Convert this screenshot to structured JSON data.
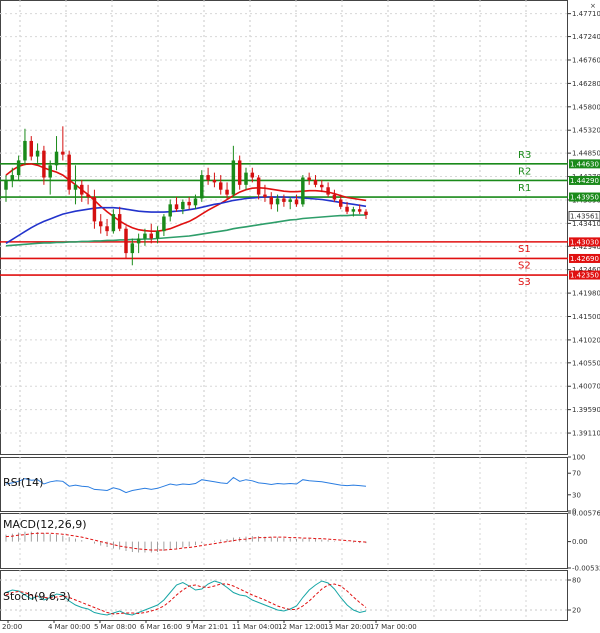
{
  "chart_data": {
    "type": "candlestick",
    "price_axis": {
      "ylim": [
        1.3866,
        1.4799
      ],
      "ticks": [
        1.4771,
        1.4724,
        1.4676,
        1.4628,
        1.458,
        1.4532,
        1.4485,
        1.4437,
        1.4389,
        1.4341,
        1.4294,
        1.4246,
        1.4198,
        1.415,
        1.4102,
        1.4055,
        1.4007,
        1.3959,
        1.3911
      ],
      "tick_labels": [
        "1.47710",
        "1.47240",
        "1.46760",
        "1.46280",
        "1.45800",
        "1.45320",
        "1.44850",
        "1.44370",
        "1.43890",
        "1.43410",
        "1.42940",
        "1.42460",
        "1.41980",
        "1.41500",
        "1.41020",
        "1.40550",
        "1.40070",
        "1.39590",
        "1.39110"
      ],
      "current_price": 1.43561,
      "current_price_label": "1.43561"
    },
    "time_axis": {
      "labels": [
        "20:00",
        "4 Mar 00:00",
        "5 Mar 08:00",
        "6 Mar 16:00",
        "9 Mar 21:01",
        "11 Mar 04:00",
        "12 Mar 12:00",
        "13 Mar 20:00",
        "17 Mar 00:00"
      ]
    },
    "levels": [
      {
        "name": "R3",
        "value": 1.4463,
        "label": "1.44630",
        "color": "#1a8a1a"
      },
      {
        "name": "R2",
        "value": 1.4429,
        "label": "1.44290",
        "color": "#1a8a1a"
      },
      {
        "name": "R1",
        "value": 1.4395,
        "label": "1.43950",
        "color": "#1a8a1a"
      },
      {
        "name": "S1",
        "value": 1.4303,
        "label": "1.43030",
        "color": "#e01010"
      },
      {
        "name": "S2",
        "value": 1.4269,
        "label": "1.42690",
        "color": "#e01010"
      },
      {
        "name": "S3",
        "value": 1.4235,
        "label": "1.42350",
        "color": "#e01010"
      }
    ],
    "candles": [
      [
        1.441,
        1.444,
        1.4385,
        1.4428
      ],
      [
        1.4428,
        1.4455,
        1.4415,
        1.444
      ],
      [
        1.444,
        1.448,
        1.443,
        1.447
      ],
      [
        1.447,
        1.4535,
        1.446,
        1.451
      ],
      [
        1.451,
        1.452,
        1.447,
        1.4478
      ],
      [
        1.4478,
        1.4505,
        1.4465,
        1.449
      ],
      [
        1.449,
        1.45,
        1.442,
        1.4435
      ],
      [
        1.4435,
        1.447,
        1.44,
        1.446
      ],
      [
        1.446,
        1.452,
        1.445,
        1.4488
      ],
      [
        1.4488,
        1.454,
        1.447,
        1.4482
      ],
      [
        1.4482,
        1.449,
        1.44,
        1.441
      ],
      [
        1.441,
        1.446,
        1.438,
        1.442
      ],
      [
        1.442,
        1.443,
        1.4385,
        1.44
      ],
      [
        1.44,
        1.442,
        1.438,
        1.4395
      ],
      [
        1.4395,
        1.441,
        1.433,
        1.4345
      ],
      [
        1.4345,
        1.436,
        1.432,
        1.4335
      ],
      [
        1.4335,
        1.435,
        1.4315,
        1.4325
      ],
      [
        1.4325,
        1.437,
        1.432,
        1.436
      ],
      [
        1.436,
        1.4375,
        1.4325,
        1.433
      ],
      [
        1.433,
        1.4335,
        1.427,
        1.428
      ],
      [
        1.428,
        1.431,
        1.4255,
        1.43
      ],
      [
        1.43,
        1.432,
        1.428,
        1.431
      ],
      [
        1.431,
        1.433,
        1.4295,
        1.432
      ],
      [
        1.432,
        1.434,
        1.43,
        1.431
      ],
      [
        1.431,
        1.4335,
        1.43,
        1.4325
      ],
      [
        1.4325,
        1.436,
        1.4315,
        1.4355
      ],
      [
        1.4355,
        1.439,
        1.4345,
        1.438
      ],
      [
        1.438,
        1.4395,
        1.4365,
        1.437
      ],
      [
        1.437,
        1.439,
        1.436,
        1.4385
      ],
      [
        1.4385,
        1.4395,
        1.437,
        1.4378
      ],
      [
        1.4378,
        1.44,
        1.437,
        1.4392
      ],
      [
        1.4392,
        1.445,
        1.4385,
        1.444
      ],
      [
        1.444,
        1.4455,
        1.442,
        1.443
      ],
      [
        1.443,
        1.4445,
        1.4415,
        1.4425
      ],
      [
        1.4425,
        1.444,
        1.44,
        1.441
      ],
      [
        1.441,
        1.4425,
        1.439,
        1.44
      ],
      [
        1.44,
        1.45,
        1.4395,
        1.447
      ],
      [
        1.447,
        1.448,
        1.441,
        1.442
      ],
      [
        1.442,
        1.4455,
        1.441,
        1.4445
      ],
      [
        1.4445,
        1.4455,
        1.4425,
        1.4435
      ],
      [
        1.4435,
        1.444,
        1.439,
        1.44
      ],
      [
        1.44,
        1.442,
        1.4385,
        1.4395
      ],
      [
        1.4395,
        1.4405,
        1.437,
        1.438
      ],
      [
        1.438,
        1.44,
        1.4365,
        1.4392
      ],
      [
        1.4392,
        1.44,
        1.4375,
        1.4385
      ],
      [
        1.4385,
        1.4395,
        1.437,
        1.439
      ],
      [
        1.439,
        1.44,
        1.4375,
        1.438
      ],
      [
        1.438,
        1.444,
        1.4375,
        1.4435
      ],
      [
        1.4435,
        1.4445,
        1.442,
        1.443
      ],
      [
        1.443,
        1.444,
        1.4415,
        1.442
      ],
      [
        1.442,
        1.443,
        1.4405,
        1.4415
      ],
      [
        1.4415,
        1.4425,
        1.4395,
        1.44
      ],
      [
        1.44,
        1.441,
        1.4385,
        1.439
      ],
      [
        1.439,
        1.44,
        1.437,
        1.4375
      ],
      [
        1.4375,
        1.4385,
        1.436,
        1.4365
      ],
      [
        1.4365,
        1.4375,
        1.4355,
        1.437
      ],
      [
        1.437,
        1.438,
        1.436,
        1.4365
      ],
      [
        1.4365,
        1.437,
        1.435,
        1.4358
      ]
    ],
    "ma_series": [
      {
        "color": "#e01010",
        "values": [
          1.444,
          1.445,
          1.4458,
          1.4462,
          1.4463,
          1.446,
          1.4455,
          1.445,
          1.4446,
          1.444,
          1.443,
          1.442,
          1.441,
          1.44,
          1.4388,
          1.4376,
          1.4365,
          1.4355,
          1.4346,
          1.4338,
          1.4332,
          1.4328,
          1.4326,
          1.4325,
          1.4325,
          1.4327,
          1.433,
          1.4335,
          1.434,
          1.4345,
          1.4352,
          1.436,
          1.4368,
          1.4375,
          1.4382,
          1.439,
          1.4398,
          1.4405,
          1.441,
          1.4413,
          1.4414,
          1.4413,
          1.4411,
          1.4409,
          1.4407,
          1.4406,
          1.4406,
          1.4407,
          1.4408,
          1.4408,
          1.4407,
          1.4405,
          1.4402,
          1.4398,
          1.4394,
          1.4392,
          1.439,
          1.4388
        ]
      },
      {
        "color": "#2233cc",
        "values": [
          1.43,
          1.4308,
          1.4316,
          1.4324,
          1.4332,
          1.4339,
          1.4345,
          1.435,
          1.4355,
          1.436,
          1.4363,
          1.4366,
          1.4368,
          1.437,
          1.4372,
          1.4373,
          1.4373,
          1.4373,
          1.4372,
          1.437,
          1.4368,
          1.4366,
          1.4365,
          1.4364,
          1.4364,
          1.4364,
          1.4365,
          1.4366,
          1.4367,
          1.4369,
          1.4371,
          1.4374,
          1.4377,
          1.438,
          1.4382,
          1.4385,
          1.4388,
          1.439,
          1.4392,
          1.4393,
          1.4394,
          1.4395,
          1.4395,
          1.4395,
          1.4395,
          1.4394,
          1.4394,
          1.4393,
          1.4392,
          1.4391,
          1.439,
          1.4388,
          1.4386,
          1.4384,
          1.4382,
          1.438,
          1.4378,
          1.4376
        ]
      },
      {
        "color": "#2e9e6a",
        "values": [
          1.4295,
          1.4296,
          1.4297,
          1.4298,
          1.4299,
          1.43,
          1.4301,
          1.4301,
          1.4302,
          1.4302,
          1.4303,
          1.4303,
          1.4304,
          1.4304,
          1.4305,
          1.4305,
          1.4306,
          1.4306,
          1.4307,
          1.4307,
          1.4308,
          1.4308,
          1.4309,
          1.4309,
          1.431,
          1.4311,
          1.4312,
          1.4313,
          1.4314,
          1.4315,
          1.4317,
          1.4319,
          1.4321,
          1.4323,
          1.4325,
          1.4327,
          1.433,
          1.4332,
          1.4334,
          1.4336,
          1.4338,
          1.434,
          1.4342,
          1.4344,
          1.4346,
          1.4348,
          1.4349,
          1.4351,
          1.4352,
          1.4353,
          1.4354,
          1.4355,
          1.4356,
          1.4357,
          1.4357,
          1.4358,
          1.4358,
          1.4358
        ]
      }
    ],
    "rsi": {
      "label": "RSI(14)",
      "ylim": [
        0,
        100
      ],
      "ticks": [
        100,
        70,
        30,
        0
      ],
      "tick_labels": [
        "100",
        "70",
        "30",
        "0"
      ],
      "values": [
        50,
        52,
        55,
        60,
        57,
        58,
        50,
        54,
        56,
        55,
        46,
        48,
        46,
        45,
        40,
        39,
        38,
        43,
        40,
        34,
        38,
        40,
        42,
        40,
        42,
        46,
        50,
        48,
        50,
        49,
        51,
        58,
        56,
        54,
        52,
        51,
        62,
        55,
        58,
        56,
        52,
        51,
        49,
        51,
        50,
        51,
        50,
        58,
        56,
        55,
        54,
        52,
        50,
        48,
        47,
        48,
        47,
        46
      ],
      "color": "#2a7de1"
    },
    "macd": {
      "label": "MACD(12,26,9)",
      "ylim": [
        -0.005322,
        0.005764
      ],
      "ticks": [
        0.005764,
        0.0,
        -0.005322
      ],
      "tick_labels": [
        "0.005764",
        "0.00",
        "-0.005322"
      ],
      "histogram": [
        0.0014,
        0.0016,
        0.0018,
        0.002,
        0.002,
        0.0019,
        0.0017,
        0.0015,
        0.0014,
        0.0012,
        0.0009,
        0.0006,
        0.0003,
        0.0,
        -0.0004,
        -0.0008,
        -0.0011,
        -0.0014,
        -0.0016,
        -0.0019,
        -0.0021,
        -0.0022,
        -0.0022,
        -0.0022,
        -0.0021,
        -0.0019,
        -0.0016,
        -0.0014,
        -0.0012,
        -0.001,
        -0.0007,
        -0.0003,
        0.0,
        0.0002,
        0.0004,
        0.0005,
        0.0008,
        0.0009,
        0.001,
        0.0011,
        0.0011,
        0.001,
        0.0009,
        0.0008,
        0.0007,
        0.0006,
        0.0005,
        0.0006,
        0.0006,
        0.0005,
        0.0004,
        0.0003,
        0.0001,
        0.0,
        -0.0001,
        -0.0002,
        -0.0003,
        -0.0003
      ],
      "signal": [
        0.001,
        0.0011,
        0.0013,
        0.0014,
        0.0016,
        0.0017,
        0.0017,
        0.0017,
        0.0016,
        0.0015,
        0.0013,
        0.0011,
        0.0009,
        0.0006,
        0.0003,
        0.0,
        -0.0003,
        -0.0006,
        -0.0009,
        -0.0011,
        -0.0013,
        -0.0015,
        -0.0016,
        -0.0017,
        -0.0017,
        -0.0017,
        -0.0016,
        -0.0015,
        -0.0013,
        -0.0012,
        -0.001,
        -0.0008,
        -0.0006,
        -0.0004,
        -0.0002,
        0.0,
        0.0002,
        0.0004,
        0.0005,
        0.0007,
        0.0008,
        0.0008,
        0.0009,
        0.0009,
        0.0009,
        0.0008,
        0.0008,
        0.0007,
        0.0007,
        0.0006,
        0.0006,
        0.0005,
        0.0004,
        0.0003,
        0.0002,
        0.0001,
        0.0,
        -0.0001
      ],
      "hist_color": "#888888",
      "signal_color": "#e01010"
    },
    "stoch": {
      "label": "Stoch(9,6,3)",
      "ticks": [
        80,
        20
      ],
      "tick_labels": [
        "80",
        "20"
      ],
      "ylim": [
        0,
        100
      ],
      "k": [
        55,
        60,
        58,
        50,
        42,
        48,
        40,
        45,
        52,
        50,
        38,
        30,
        25,
        22,
        15,
        12,
        10,
        14,
        18,
        12,
        10,
        15,
        20,
        25,
        30,
        40,
        55,
        70,
        75,
        68,
        60,
        62,
        72,
        78,
        74,
        65,
        55,
        50,
        48,
        40,
        35,
        30,
        25,
        20,
        18,
        22,
        28,
        45,
        60,
        70,
        78,
        74,
        62,
        45,
        30,
        20,
        15,
        18
      ],
      "d": [
        50,
        55,
        57,
        55,
        50,
        47,
        45,
        44,
        46,
        48,
        45,
        40,
        35,
        30,
        25,
        20,
        15,
        12,
        13,
        14,
        14,
        13,
        15,
        18,
        22,
        28,
        38,
        50,
        60,
        68,
        70,
        66,
        65,
        68,
        72,
        72,
        68,
        62,
        56,
        50,
        45,
        40,
        34,
        28,
        24,
        21,
        21,
        28,
        38,
        50,
        62,
        70,
        72,
        68,
        58,
        46,
        35,
        25
      ],
      "k_color": "#17a6a6",
      "d_color": "#e01010"
    }
  }
}
